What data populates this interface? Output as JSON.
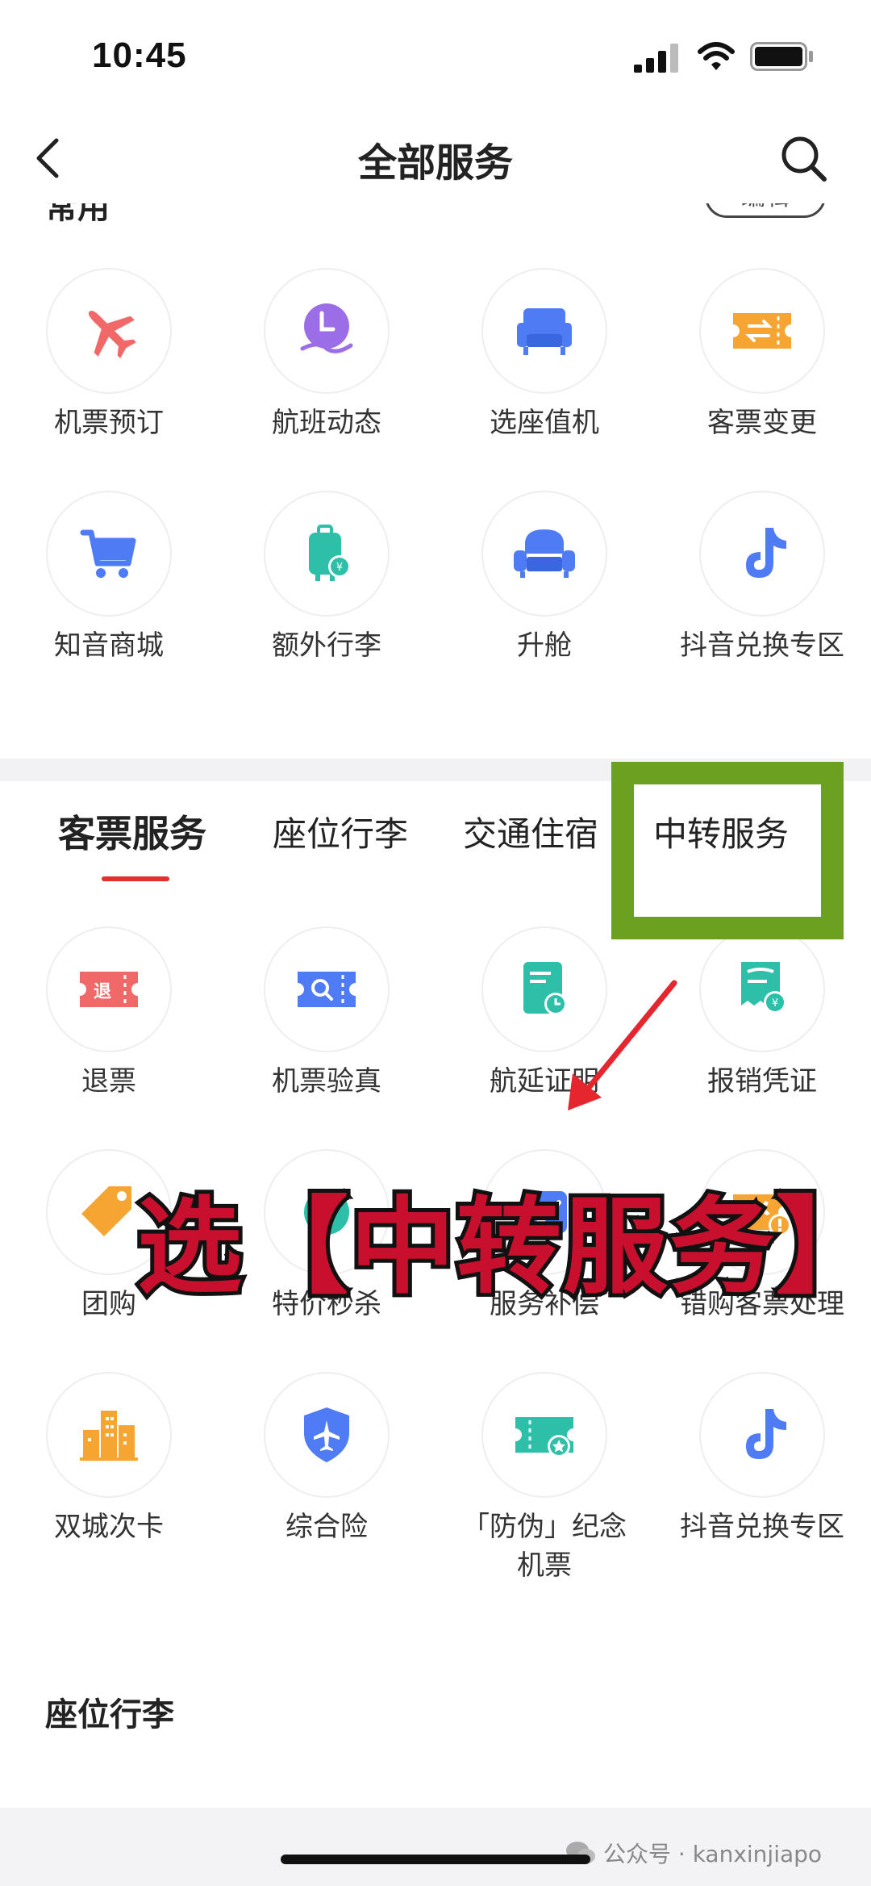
{
  "status": {
    "time": "10:45"
  },
  "header": {
    "title": "全部服务"
  },
  "partial": {
    "section_label": "常用",
    "edit_label": "编辑"
  },
  "common": [
    {
      "label": "机票预订",
      "icon": "plane-icon"
    },
    {
      "label": "航班动态",
      "icon": "clock-hand-icon"
    },
    {
      "label": "选座值机",
      "icon": "seat-icon"
    },
    {
      "label": "客票变更",
      "icon": "ticket-exchange-icon"
    },
    {
      "label": "知音商城",
      "icon": "cart-icon"
    },
    {
      "label": "额外行李",
      "icon": "luggage-icon"
    },
    {
      "label": "升舱",
      "icon": "sofa-icon"
    },
    {
      "label": "抖音兑换专区",
      "icon": "tiktok-icon"
    }
  ],
  "tabs": [
    {
      "label": "客票服务",
      "active": true
    },
    {
      "label": "座位行李"
    },
    {
      "label": "交通住宿"
    },
    {
      "label": "中转服务"
    }
  ],
  "ticket_services": [
    {
      "label": "退票",
      "icon": "refund-ticket-icon"
    },
    {
      "label": "机票验真",
      "icon": "ticket-verify-icon"
    },
    {
      "label": "航延证明",
      "icon": "delay-certificate-icon"
    },
    {
      "label": "报销凭证",
      "icon": "receipt-icon"
    },
    {
      "label": "团购",
      "icon": "tag-icon"
    },
    {
      "label": "特价秒杀",
      "icon": "flash-sale-icon"
    },
    {
      "label": "服务补偿",
      "icon": "compensation-icon"
    },
    {
      "label": "错购客票处理",
      "icon": "ticket-alert-icon"
    },
    {
      "label": "双城次卡",
      "icon": "city-building-icon"
    },
    {
      "label": "综合险",
      "icon": "shield-plane-icon"
    },
    {
      "label": "「防伪」纪念机票",
      "icon": "star-ticket-icon"
    },
    {
      "label": "抖音兑换专区",
      "icon": "tiktok-icon"
    }
  ],
  "section2": {
    "title": "座位行李"
  },
  "overlay": {
    "text": "选【中转服务】"
  },
  "watermark": {
    "text": "公众号 · kanxinjiapo"
  },
  "colors": {
    "accent_red": "#e03030",
    "highlight_green": "#6ca021",
    "overlay_red": "#c8102e"
  }
}
